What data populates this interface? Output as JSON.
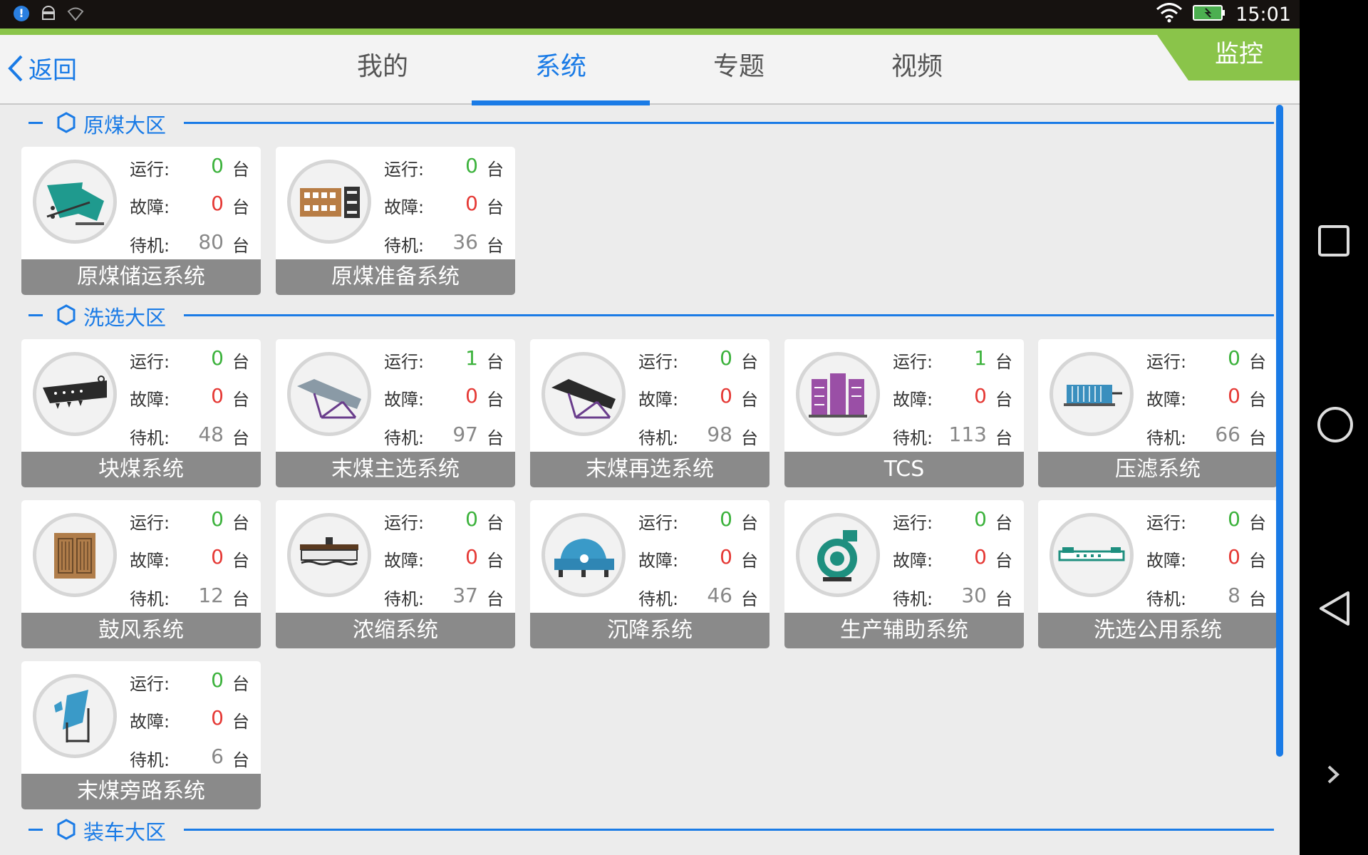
{
  "status_bar": {
    "time": "15:01"
  },
  "header": {
    "back_label": "返回",
    "tabs": [
      {
        "label": "我的",
        "active": false
      },
      {
        "label": "系统",
        "active": true
      },
      {
        "label": "专题",
        "active": false
      },
      {
        "label": "视频",
        "active": false
      }
    ],
    "monitor_label": "监控"
  },
  "labels": {
    "running": "运行:",
    "fault": "故障:",
    "standby": "待机:",
    "unit": "台"
  },
  "colors": {
    "accent": "#1a7be6",
    "green": "#8ac44a",
    "running": "#3cb23c",
    "fault": "#e53935"
  },
  "sections": [
    {
      "title": "原煤大区"
    },
    {
      "title": "洗选大区"
    },
    {
      "title": "装车大区"
    }
  ],
  "cards": [
    {
      "name": "原煤储运系统",
      "running": "0",
      "fault": "0",
      "standby": "80",
      "icon": "conveyor-feeder-icon"
    },
    {
      "name": "原煤准备系统",
      "running": "0",
      "fault": "0",
      "standby": "36",
      "icon": "crusher-icon"
    },
    {
      "name": "块煤系统",
      "running": "0",
      "fault": "0",
      "standby": "48",
      "icon": "jig-icon"
    },
    {
      "name": "末煤主选系统",
      "running": "1",
      "fault": "0",
      "standby": "97",
      "icon": "cyclone-icon"
    },
    {
      "name": "末煤再选系统",
      "running": "0",
      "fault": "0",
      "standby": "98",
      "icon": "cyclone-dark-icon"
    },
    {
      "name": "TCS",
      "running": "1",
      "fault": "0",
      "standby": "113",
      "icon": "tcs-machine-icon"
    },
    {
      "name": "压滤系统",
      "running": "0",
      "fault": "0",
      "standby": "66",
      "icon": "filter-press-icon"
    },
    {
      "name": "鼓风系统",
      "running": "0",
      "fault": "0",
      "standby": "12",
      "icon": "blower-cabinet-icon"
    },
    {
      "name": "浓缩系统",
      "running": "0",
      "fault": "0",
      "standby": "37",
      "icon": "thickener-icon"
    },
    {
      "name": "沉降系统",
      "running": "0",
      "fault": "0",
      "standby": "46",
      "icon": "centrifuge-icon"
    },
    {
      "name": "生产辅助系统",
      "running": "0",
      "fault": "0",
      "standby": "30",
      "icon": "pump-icon"
    },
    {
      "name": "洗选公用系统",
      "running": "0",
      "fault": "0",
      "standby": "8",
      "icon": "utility-rack-icon"
    },
    {
      "name": "末煤旁路系统",
      "running": "0",
      "fault": "0",
      "standby": "6",
      "icon": "sieve-bend-icon"
    }
  ]
}
